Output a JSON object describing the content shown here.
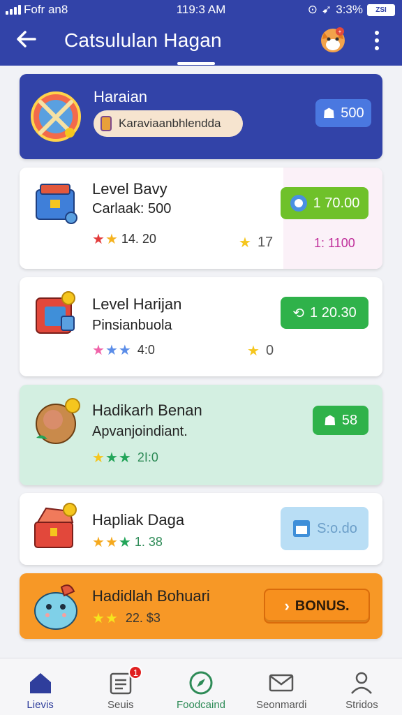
{
  "status_bar": {
    "carrier": "Fofr an8",
    "time": "119:3 AM",
    "battery_pct": "3:3%",
    "battery_label": "ZSI"
  },
  "header": {
    "title": "Catsululan Hagan",
    "icons": [
      "back-arrow-icon",
      "fox-avatar-icon",
      "more-vertical-icon"
    ]
  },
  "cards": [
    {
      "name": "Haraian",
      "tag": "Karaviaanbhlendda",
      "button": "500",
      "icon": "swords-badge-icon",
      "accent": "#3243a8"
    },
    {
      "name": "Level Bavy",
      "sub": "Carlaak: 500",
      "rating": "14. 20",
      "stars": [
        "#e23b3b",
        "#f5b21e"
      ],
      "count": "17",
      "button": "1 70.00",
      "extra": "1: 1100",
      "icon": "briefcase-icon"
    },
    {
      "name": "Level Harijan",
      "sub": "Pinsianbuola",
      "rating": "4:0",
      "stars": [
        "#f062a8",
        "#5b8de8",
        "#5b8de8"
      ],
      "count": "0",
      "button": "1 20.30",
      "icon": "gift-box-icon"
    },
    {
      "name": "Hadikarh Benan",
      "sub": "Apvanjoindiant.",
      "rating": "2I:0",
      "stars": [
        "#f5c61e",
        "#22a559",
        "#22a559"
      ],
      "button": "58",
      "icon": "bear-coin-icon"
    },
    {
      "name": "Hapliak Daga",
      "rating": "1. 38",
      "stars": [
        "#f5a91e",
        "#f5a91e",
        "#22a559"
      ],
      "button": "S:o.do",
      "icon": "treasure-chest-icon"
    },
    {
      "name": "Hadidlah Bohuari",
      "rating": "22. $3",
      "stars": [
        "#f5c61e",
        "#f5c61e"
      ],
      "button": "BONUS.",
      "icon": "creature-icon",
      "accent": "#f79826"
    }
  ],
  "bottom_nav": [
    {
      "label": "Lievis",
      "icon": "home-icon",
      "active": true
    },
    {
      "label": "Seuis",
      "icon": "list-icon",
      "badge": "1"
    },
    {
      "label": "Foodcaind",
      "icon": "compass-icon"
    },
    {
      "label": "Seonmardi",
      "icon": "mail-icon"
    },
    {
      "label": "Stridos",
      "icon": "person-icon"
    }
  ]
}
